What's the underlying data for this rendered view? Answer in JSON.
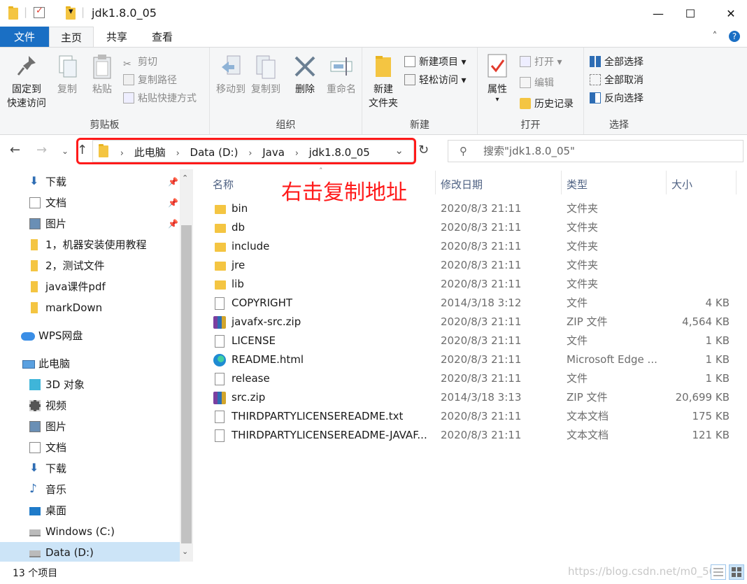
{
  "window": {
    "title": "jdk1.8.0_05",
    "minimize": "—",
    "maximize": "☐",
    "close": "✕"
  },
  "qat": {
    "dropdown": "▾"
  },
  "tabs": {
    "file": "文件",
    "home": "主页",
    "share": "共享",
    "view": "查看",
    "collapse": "˄",
    "help": "?"
  },
  "ribbon": {
    "clipboard": {
      "label": "剪贴板",
      "pin": [
        "固定到",
        "快速访问"
      ],
      "copy": "复制",
      "paste": "粘贴",
      "cut": "剪切",
      "copy_path": "复制路径",
      "paste_shortcut": "粘贴快捷方式"
    },
    "organize": {
      "label": "组织",
      "move_to": "移动到",
      "copy_to": "复制到",
      "delete": "删除",
      "rename": "重命名"
    },
    "new": {
      "label": "新建",
      "new_folder": [
        "新建",
        "文件夹"
      ],
      "new_item": "新建项目",
      "easy_access": "轻松访问"
    },
    "open": {
      "label": "打开",
      "properties": "属性",
      "open": "打开",
      "edit": "编辑",
      "history": "历史记录"
    },
    "select": {
      "label": "选择",
      "select_all": "全部选择",
      "select_none": "全部取消",
      "invert": "反向选择"
    }
  },
  "address": {
    "crumbs": [
      "此电脑",
      "Data (D:)",
      "Java",
      "jdk1.8.0_05"
    ],
    "search_placeholder": "搜索\"jdk1.8.0_05\""
  },
  "annotation": "右击复制地址",
  "nav": {
    "items": [
      {
        "label": "下载",
        "icon": "download-icon",
        "pinned": true
      },
      {
        "label": "文档",
        "icon": "document-icon",
        "pinned": true
      },
      {
        "label": "图片",
        "icon": "picture-icon",
        "pinned": true
      },
      {
        "label": "1，机器安装使用教程",
        "icon": "folder-icon"
      },
      {
        "label": "2，测试文件",
        "icon": "folder-icon"
      },
      {
        "label": "java课件pdf",
        "icon": "folder-icon"
      },
      {
        "label": "markDown",
        "icon": "folder-icon"
      },
      {
        "label": "WPS网盘",
        "icon": "cloud-icon"
      },
      {
        "label": "此电脑",
        "icon": "computer-icon"
      },
      {
        "label": "3D 对象",
        "icon": "3d-objects-icon"
      },
      {
        "label": "视频",
        "icon": "video-icon"
      },
      {
        "label": "图片",
        "icon": "picture-icon"
      },
      {
        "label": "文档",
        "icon": "document-icon"
      },
      {
        "label": "下载",
        "icon": "download-icon"
      },
      {
        "label": "音乐",
        "icon": "music-icon"
      },
      {
        "label": "桌面",
        "icon": "desktop-icon"
      },
      {
        "label": "Windows (C:)",
        "icon": "drive-icon"
      },
      {
        "label": "Data (D:)",
        "icon": "drive-icon",
        "selected": true
      }
    ]
  },
  "columns": {
    "name": "名称",
    "date": "修改日期",
    "type": "类型",
    "size": "大小"
  },
  "files": [
    {
      "name": "bin",
      "date": "2020/8/3 21:11",
      "type": "文件夹",
      "size": "",
      "icon": "folder"
    },
    {
      "name": "db",
      "date": "2020/8/3 21:11",
      "type": "文件夹",
      "size": "",
      "icon": "folder"
    },
    {
      "name": "include",
      "date": "2020/8/3 21:11",
      "type": "文件夹",
      "size": "",
      "icon": "folder"
    },
    {
      "name": "jre",
      "date": "2020/8/3 21:11",
      "type": "文件夹",
      "size": "",
      "icon": "folder"
    },
    {
      "name": "lib",
      "date": "2020/8/3 21:11",
      "type": "文件夹",
      "size": "",
      "icon": "folder"
    },
    {
      "name": "COPYRIGHT",
      "date": "2014/3/18 3:12",
      "type": "文件",
      "size": "4 KB",
      "icon": "file"
    },
    {
      "name": "javafx-src.zip",
      "date": "2020/8/3 21:11",
      "type": "ZIP 文件",
      "size": "4,564 KB",
      "icon": "zip"
    },
    {
      "name": "LICENSE",
      "date": "2020/8/3 21:11",
      "type": "文件",
      "size": "1 KB",
      "icon": "file"
    },
    {
      "name": "README.html",
      "date": "2020/8/3 21:11",
      "type": "Microsoft Edge ...",
      "size": "1 KB",
      "icon": "edge"
    },
    {
      "name": "release",
      "date": "2020/8/3 21:11",
      "type": "文件",
      "size": "1 KB",
      "icon": "file"
    },
    {
      "name": "src.zip",
      "date": "2014/3/18 3:13",
      "type": "ZIP 文件",
      "size": "20,699 KB",
      "icon": "zip"
    },
    {
      "name": "THIRDPARTYLICENSEREADME.txt",
      "date": "2020/8/3 21:11",
      "type": "文本文档",
      "size": "175 KB",
      "icon": "file"
    },
    {
      "name": "THIRDPARTYLICENSEREADME-JAVAF...",
      "date": "2020/8/3 21:11",
      "type": "文本文档",
      "size": "121 KB",
      "icon": "file"
    }
  ],
  "status": {
    "count": "13 个项目",
    "watermark": "https://blog.csdn.net/m0_50"
  }
}
